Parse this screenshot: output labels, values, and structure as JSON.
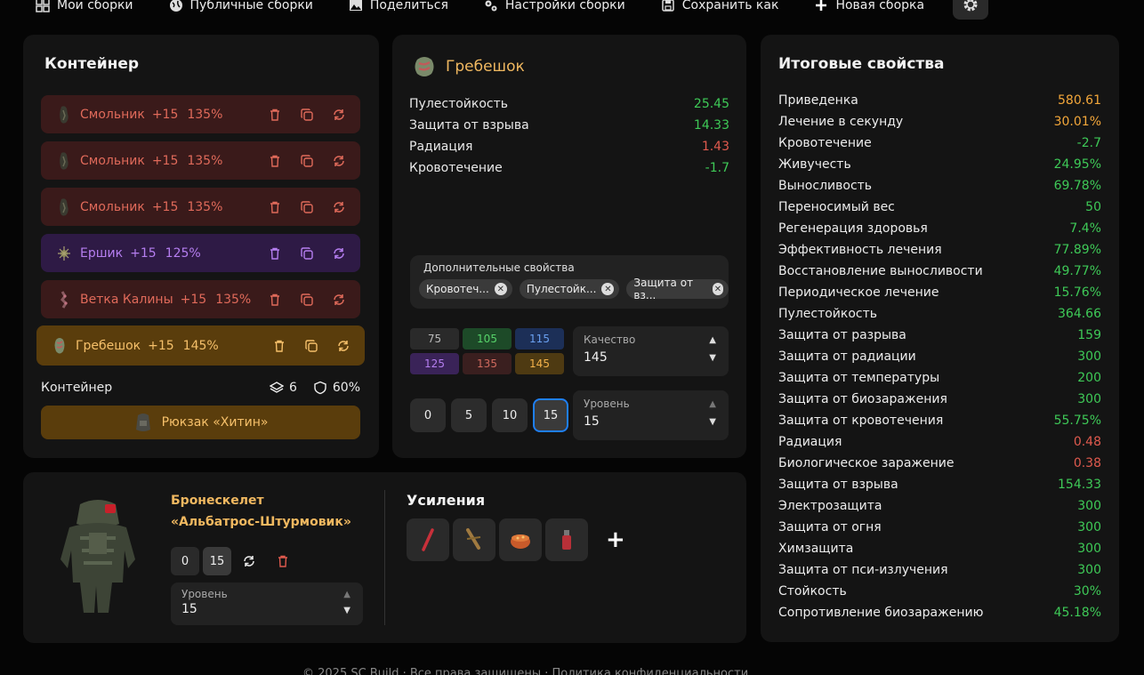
{
  "nav": {
    "items": [
      {
        "label": "Мои сборки",
        "icon": "grid-icon"
      },
      {
        "label": "Публичные сборки",
        "icon": "globe-icon"
      },
      {
        "label": "Поделиться",
        "icon": "image-icon"
      },
      {
        "label": "Настройки сборки",
        "icon": "gears-icon"
      },
      {
        "label": "Сохранить как",
        "icon": "floppy-icon"
      },
      {
        "label": "Новая сборка",
        "icon": "plus-icon"
      }
    ]
  },
  "container": {
    "title": "Контейнер",
    "rows": [
      {
        "name": "Смольник",
        "level": "+15",
        "quality": "135%",
        "color": "red"
      },
      {
        "name": "Смольник",
        "level": "+15",
        "quality": "135%",
        "color": "red"
      },
      {
        "name": "Смольник",
        "level": "+15",
        "quality": "135%",
        "color": "red"
      },
      {
        "name": "Ершик",
        "level": "+15",
        "quality": "125%",
        "color": "purple"
      },
      {
        "name": "Ветка Калины",
        "level": "+15",
        "quality": "135%",
        "color": "red"
      },
      {
        "name": "Гребешок",
        "level": "+15",
        "quality": "145%",
        "color": "gold"
      }
    ],
    "footer_label": "Контейнер",
    "slots": "6",
    "protection": "60%",
    "backpack": "Рюкзак «Хитин»"
  },
  "detail": {
    "name": "Гребешок",
    "stats": [
      {
        "label": "Пулестойкость",
        "value": "25.45",
        "tone": "g"
      },
      {
        "label": "Защита от взрыва",
        "value": "14.33",
        "tone": "g"
      },
      {
        "label": "Радиация",
        "value": "1.43",
        "tone": "r"
      },
      {
        "label": "Кровотечение",
        "value": "-1.7",
        "tone": "g"
      }
    ],
    "extra_label": "Дополнительные свойства",
    "chips": [
      "Кровотеч...",
      "Пулестойк...",
      "Защита от вз..."
    ],
    "quality_cells": [
      {
        "v": "75",
        "bg": "#2a2a2a",
        "fg": "#bbbbbb"
      },
      {
        "v": "105",
        "bg": "#1d4a28",
        "fg": "#57d36a"
      },
      {
        "v": "115",
        "bg": "#1c2f57",
        "fg": "#6aa0f0"
      },
      {
        "v": "125",
        "bg": "#3a2358",
        "fg": "#b57ef0"
      },
      {
        "v": "135",
        "bg": "#3a1f1f",
        "fg": "#d06a5e"
      },
      {
        "v": "145",
        "bg": "#4e3a12",
        "fg": "#f3b24a"
      }
    ],
    "quality_label": "Качество",
    "quality_value": "145",
    "level_buttons": [
      "0",
      "5",
      "10",
      "15"
    ],
    "level_label": "Уровень",
    "level_value": "15"
  },
  "armor": {
    "name_line1": "Бронескелет",
    "name_line2": "«Альбатрос-Штурмовик»",
    "btn_0": "0",
    "btn_15": "15",
    "level_label": "Уровень",
    "level_value": "15",
    "boost_title": "Усиления",
    "add": "+"
  },
  "summary": {
    "title": "Итоговые свойства",
    "rows": [
      {
        "label": "Приведенка",
        "value": "580.61",
        "tone": "o"
      },
      {
        "label": "Лечение в секунду",
        "value": "30.01%",
        "tone": "o"
      },
      {
        "label": "Кровотечение",
        "value": "-2.7",
        "tone": "g"
      },
      {
        "label": "Живучесть",
        "value": "24.95%",
        "tone": "g"
      },
      {
        "label": "Выносливость",
        "value": "69.78%",
        "tone": "g"
      },
      {
        "label": "Переносимый вес",
        "value": "50",
        "tone": "g"
      },
      {
        "label": "Регенерация здоровья",
        "value": "7.4%",
        "tone": "g"
      },
      {
        "label": "Эффективность лечения",
        "value": "77.89%",
        "tone": "g"
      },
      {
        "label": "Восстановление выносливости",
        "value": "49.77%",
        "tone": "g"
      },
      {
        "label": "Периодическое лечение",
        "value": "15.76%",
        "tone": "g"
      },
      {
        "label": "Пулестойкость",
        "value": "364.66",
        "tone": "g"
      },
      {
        "label": "Защита от разрыва",
        "value": "159",
        "tone": "g"
      },
      {
        "label": "Защита от радиации",
        "value": "300",
        "tone": "g"
      },
      {
        "label": "Защита от температуры",
        "value": "200",
        "tone": "g"
      },
      {
        "label": "Защита от биозаражения",
        "value": "300",
        "tone": "g"
      },
      {
        "label": "Защита от кровотечения",
        "value": "55.75%",
        "tone": "g"
      },
      {
        "label": "Радиация",
        "value": "0.48",
        "tone": "r"
      },
      {
        "label": "Биологическое заражение",
        "value": "0.38",
        "tone": "r"
      },
      {
        "label": "Защита от взрыва",
        "value": "154.33",
        "tone": "g"
      },
      {
        "label": "Электрозащита",
        "value": "300",
        "tone": "g"
      },
      {
        "label": "Защита от огня",
        "value": "300",
        "tone": "g"
      },
      {
        "label": "Химзащита",
        "value": "300",
        "tone": "g"
      },
      {
        "label": "Защита от пси-излучения",
        "value": "300",
        "tone": "g"
      },
      {
        "label": "Стойкость",
        "value": "30%",
        "tone": "g"
      },
      {
        "label": "Сопротивление биозаражению",
        "value": "45.18%",
        "tone": "g"
      }
    ]
  }
}
